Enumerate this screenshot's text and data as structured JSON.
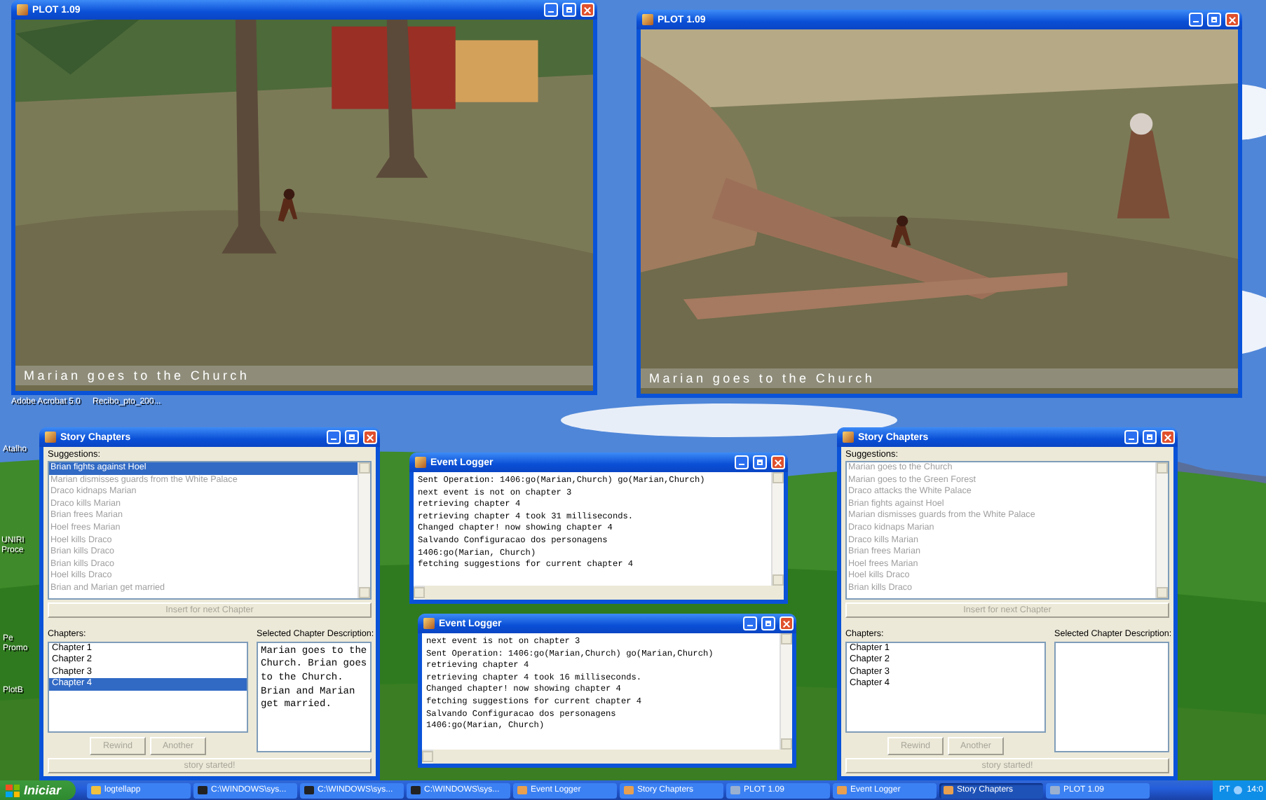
{
  "desktop_icons": [
    {
      "label": "Adobe Acrobat 5.0"
    },
    {
      "label": "Recibo_pto_200..."
    },
    {
      "label": "Atalho"
    },
    {
      "label": "UNIRI Proce"
    },
    {
      "label": "Pe Promo"
    },
    {
      "label": "PlotB"
    }
  ],
  "windows": [
    {
      "kind": "game",
      "title": "PLOT 1.09",
      "caption": "Marian goes to the Church"
    },
    {
      "kind": "game",
      "title": "PLOT 1.09",
      "caption": "Marian goes to the Church"
    },
    {
      "kind": "chapters",
      "title": "Story Chapters",
      "suggestions_label": "Suggestions:",
      "suggestions": [
        {
          "label": "Brian fights against Hoel",
          "selected": true
        },
        {
          "label": "Marian dismisses guards from the White Palace",
          "selected": false
        },
        {
          "label": "Draco kidnaps Marian",
          "selected": false
        },
        {
          "label": "Draco kills Marian",
          "selected": false
        },
        {
          "label": "Brian frees Marian",
          "selected": false
        },
        {
          "label": "Hoel frees Marian",
          "selected": false
        },
        {
          "label": "Hoel kills Draco",
          "selected": false
        },
        {
          "label": "Brian kills Draco",
          "selected": false
        },
        {
          "label": "Brian kills Draco",
          "selected": false
        },
        {
          "label": "Hoel kills Draco",
          "selected": false
        },
        {
          "label": "Brian and Marian get married",
          "selected": false
        }
      ],
      "insert_button": "Insert for next Chapter",
      "chapters_label": "Chapters:",
      "chapters": [
        {
          "label": "Chapter 1",
          "selected": false
        },
        {
          "label": "Chapter 2",
          "selected": false
        },
        {
          "label": "Chapter 3",
          "selected": false
        },
        {
          "label": "Chapter 4",
          "selected": true
        }
      ],
      "description_label": "Selected Chapter Description:",
      "description": "Marian goes to the Church. Brian goes to the Church. Brian and Marian get married.",
      "buttons": [
        "Rewind",
        "Another"
      ],
      "status_button": "story started!"
    },
    {
      "kind": "logger",
      "title": "Event Logger",
      "lines": [
        "Sent Operation: 1406:go(Marian,Church) go(Marian,Church)",
        "next event is not on chapter 3",
        "retrieving chapter 4",
        "retrieving chapter 4 took 31 milliseconds.",
        "Changed chapter! now showing chapter 4",
        "Salvando Configuracao dos personagens",
        "1406:go(Marian, Church)",
        "fetching suggestions for current chapter 4"
      ]
    },
    {
      "kind": "logger",
      "title": "Event Logger",
      "lines": [
        "next event is not on chapter 3",
        "Sent Operation: 1406:go(Marian,Church) go(Marian,Church)",
        "retrieving chapter 4",
        "retrieving chapter 4 took 16 milliseconds.",
        "Changed chapter! now showing chapter 4",
        "fetching suggestions for current chapter 4",
        "Salvando Configuracao dos personagens",
        "1406:go(Marian, Church)"
      ]
    },
    {
      "kind": "chapters",
      "title": "Story Chapters",
      "suggestions_label": "Suggestions:",
      "suggestions": [
        {
          "label": "Marian goes to the Church",
          "selected": false
        },
        {
          "label": "Marian goes to the Green Forest",
          "selected": false
        },
        {
          "label": "Draco attacks the White Palace",
          "selected": false
        },
        {
          "label": "Brian fights against Hoel",
          "selected": false
        },
        {
          "label": "Marian dismisses guards from the White Palace",
          "selected": false
        },
        {
          "label": "Draco kidnaps Marian",
          "selected": false
        },
        {
          "label": "Draco kills Marian",
          "selected": false
        },
        {
          "label": "Brian frees Marian",
          "selected": false
        },
        {
          "label": "Hoel frees Marian",
          "selected": false
        },
        {
          "label": "Hoel kills Draco",
          "selected": false
        },
        {
          "label": "Brian kills Draco",
          "selected": false
        }
      ],
      "insert_button": "Insert for next Chapter",
      "chapters_label": "Chapters:",
      "chapters": [
        {
          "label": "Chapter 1",
          "selected": false
        },
        {
          "label": "Chapter 2",
          "selected": false
        },
        {
          "label": "Chapter 3",
          "selected": false
        },
        {
          "label": "Chapter 4",
          "selected": false
        }
      ],
      "description_label": "Selected Chapter Description:",
      "buttons": [
        "Rewind",
        "Another"
      ],
      "status_button": "story started!"
    }
  ],
  "taskbar": {
    "start": "Iniciar",
    "items": [
      {
        "label": "logtellapp",
        "kind": "folder",
        "selected": false
      },
      {
        "label": "C:\\WINDOWS\\sys...",
        "kind": "console",
        "selected": false
      },
      {
        "label": "C:\\WINDOWS\\sys...",
        "kind": "console",
        "selected": false
      },
      {
        "label": "C:\\WINDOWS\\sys...",
        "kind": "console",
        "selected": false
      },
      {
        "label": "Event Logger",
        "kind": "java",
        "selected": false
      },
      {
        "label": "Story Chapters",
        "kind": "java",
        "selected": false
      },
      {
        "label": "PLOT 1.09",
        "kind": "plot",
        "selected": false
      },
      {
        "label": "Event Logger",
        "kind": "java",
        "selected": false
      },
      {
        "label": "Story Chapters",
        "kind": "java",
        "selected": true
      },
      {
        "label": "PLOT 1.09",
        "kind": "plot",
        "selected": false
      }
    ],
    "language": "PT",
    "clock": "14:0"
  }
}
